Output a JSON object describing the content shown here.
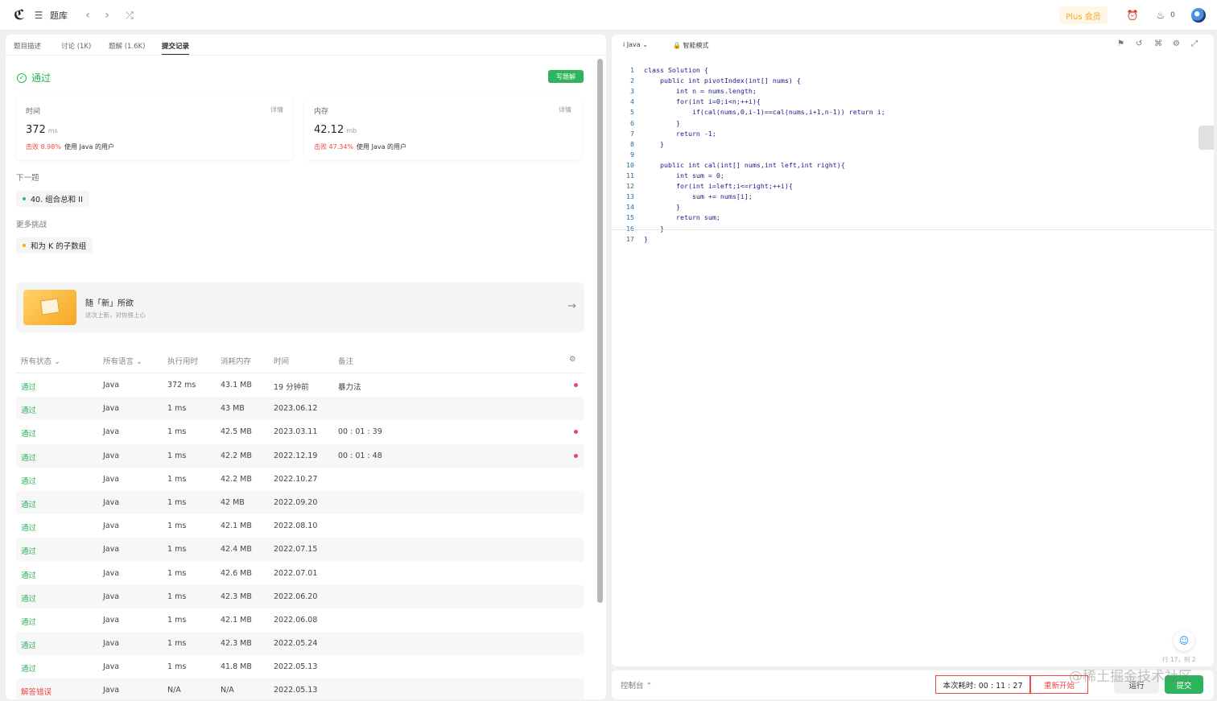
{
  "topbar": {
    "logo": "ℭ",
    "problem_bank": "题库",
    "prev": "‹",
    "next": "›",
    "shuffle": "⤮",
    "plus_member": "Plus 会员",
    "alarm_icon": "⏰",
    "fire_icon": "♨",
    "fire_count": "0"
  },
  "left_tabs": [
    "题目描述",
    "讨论 (1K)",
    "题解 (1.6K)",
    "提交记录"
  ],
  "result": {
    "status": "通过",
    "write_solution": "写题解",
    "time": {
      "label": "时间",
      "detail": "详情",
      "value": "372",
      "unit": "ms",
      "beat": "击败 8.98%",
      "users": "使用 Java 的用户"
    },
    "memory": {
      "label": "内存",
      "detail": "详情",
      "value": "42.12",
      "unit": "mb",
      "beat": "击败 47.34%",
      "users": "使用 Java 的用户"
    }
  },
  "next_problem": {
    "label": "下一题",
    "item": "40. 组合总和 II"
  },
  "more_challenges": {
    "label": "更多挑战",
    "item": "和为 K 的子数组"
  },
  "promo": {
    "title": "随「新」所欲",
    "subtitle": "这次上新，对你很上心",
    "arrow": "→"
  },
  "table": {
    "headers": [
      "所有状态 ⌄",
      "所有语言 ⌄",
      "执行用时",
      "消耗内存",
      "时间",
      "备注"
    ],
    "gear": "⚙",
    "rows": [
      {
        "status": "通过",
        "lang": "Java",
        "time": "372 ms",
        "mem": "43.1 MB",
        "date": "19 分钟前",
        "note": "暴力法",
        "mark": true
      },
      {
        "status": "通过",
        "lang": "Java",
        "time": "1 ms",
        "mem": "43 MB",
        "date": "2023.06.12",
        "note": "",
        "mark": false
      },
      {
        "status": "通过",
        "lang": "Java",
        "time": "1 ms",
        "mem": "42.5 MB",
        "date": "2023.03.11",
        "note": "00 : 01 : 39",
        "mark": true
      },
      {
        "status": "通过",
        "lang": "Java",
        "time": "1 ms",
        "mem": "42.2 MB",
        "date": "2022.12.19",
        "note": "00 : 01 : 48",
        "mark": true
      },
      {
        "status": "通过",
        "lang": "Java",
        "time": "1 ms",
        "mem": "42.2 MB",
        "date": "2022.10.27",
        "note": "",
        "mark": false
      },
      {
        "status": "通过",
        "lang": "Java",
        "time": "1 ms",
        "mem": "42 MB",
        "date": "2022.09.20",
        "note": "",
        "mark": false
      },
      {
        "status": "通过",
        "lang": "Java",
        "time": "1 ms",
        "mem": "42.1 MB",
        "date": "2022.08.10",
        "note": "",
        "mark": false
      },
      {
        "status": "通过",
        "lang": "Java",
        "time": "1 ms",
        "mem": "42.4 MB",
        "date": "2022.07.15",
        "note": "",
        "mark": false
      },
      {
        "status": "通过",
        "lang": "Java",
        "time": "1 ms",
        "mem": "42.6 MB",
        "date": "2022.07.01",
        "note": "",
        "mark": false
      },
      {
        "status": "通过",
        "lang": "Java",
        "time": "1 ms",
        "mem": "42.3 MB",
        "date": "2022.06.20",
        "note": "",
        "mark": false
      },
      {
        "status": "通过",
        "lang": "Java",
        "time": "1 ms",
        "mem": "42.1 MB",
        "date": "2022.06.08",
        "note": "",
        "mark": false
      },
      {
        "status": "通过",
        "lang": "Java",
        "time": "1 ms",
        "mem": "42.3 MB",
        "date": "2022.05.24",
        "note": "",
        "mark": false
      },
      {
        "status": "通过",
        "lang": "Java",
        "time": "1 ms",
        "mem": "41.8 MB",
        "date": "2022.05.13",
        "note": "",
        "mark": false
      },
      {
        "status": "解答错误",
        "lang": "Java",
        "time": "N/A",
        "mem": "N/A",
        "date": "2022.05.13",
        "note": "",
        "mark": false
      }
    ]
  },
  "editor": {
    "language": "Java",
    "mode": "智能模式",
    "code": [
      "class Solution {",
      "    public int pivotIndex(int[] nums) {",
      "        int n = nums.length;",
      "        for(int i=0;i<n;++i){",
      "            if(cal(nums,0,i-1)==cal(nums,i+1,n-1)) return i;",
      "        }",
      "        return -1;",
      "    }",
      "",
      "    public int cal(int[] nums,int left,int right){",
      "        int sum = 0;",
      "        for(int i=left;i<=right;++i){",
      "            sum += nums[i];",
      "        }",
      "        return sum;",
      "    }",
      "}"
    ],
    "cursor_position": "行 17，列 2"
  },
  "bottom_bar": {
    "console": "控制台 ⌃",
    "elapsed": "本次耗时: 00 : 11 : 27",
    "restart": "重新开始",
    "run": "运行",
    "submit": "提交"
  },
  "watermark": "@稀土掘金技术社区",
  "colors": {
    "green": "#2db55d",
    "red": "#ef4743",
    "mark": "#e8417a"
  }
}
